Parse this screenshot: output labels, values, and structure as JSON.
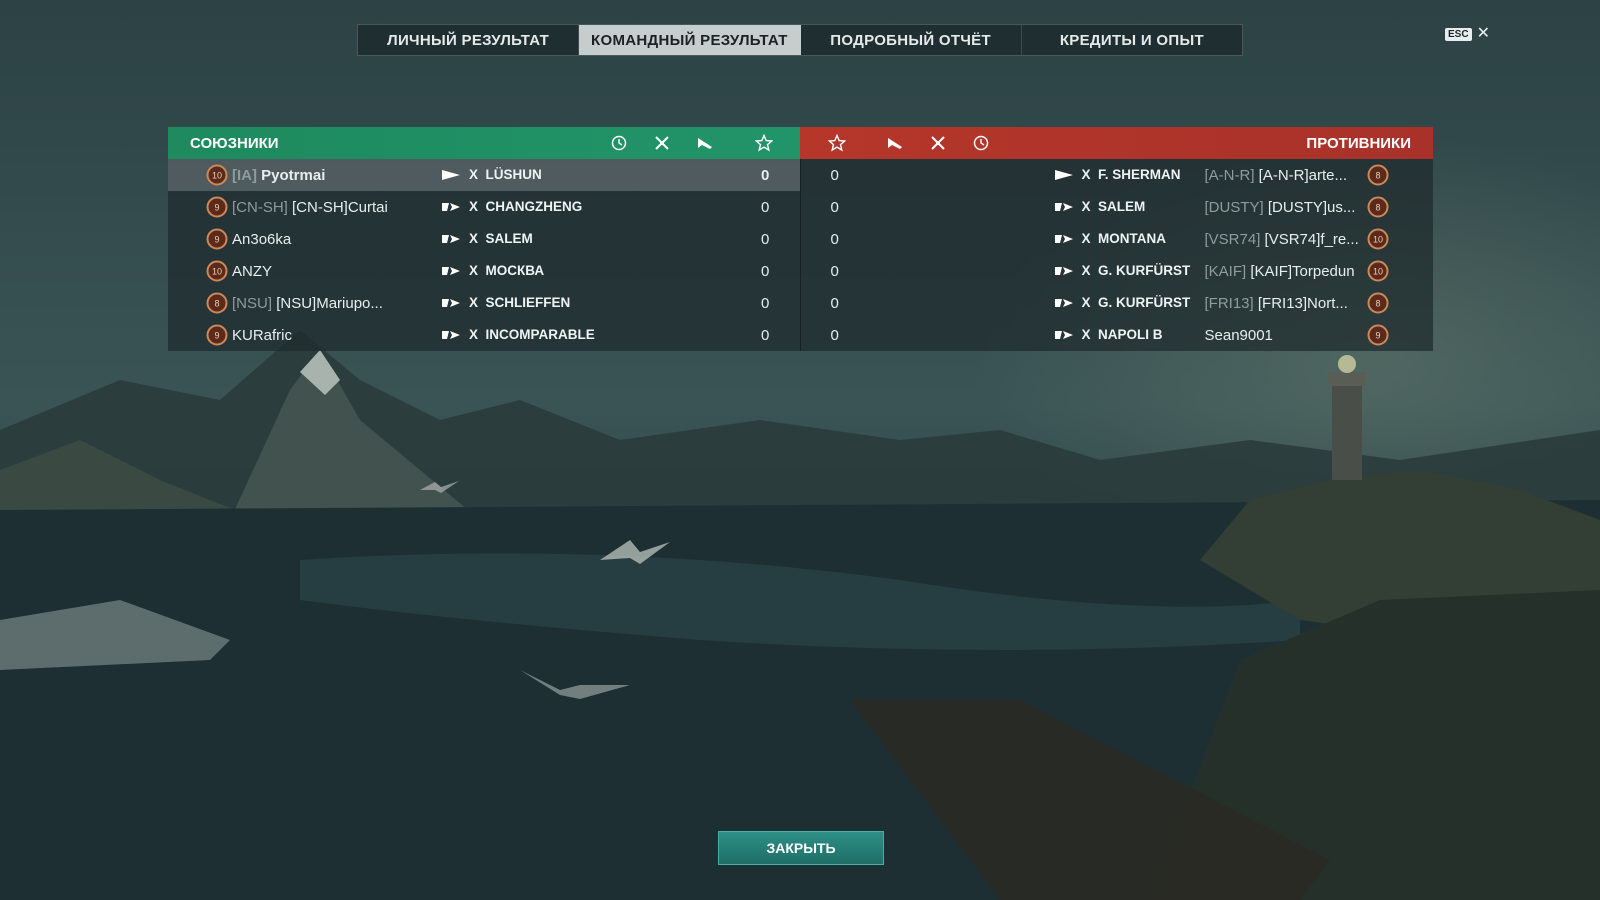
{
  "tabs": [
    {
      "label": "ЛИЧНЫЙ РЕЗУЛЬТАТ",
      "active": false
    },
    {
      "label": "КОМАНДНЫЙ РЕЗУЛЬТАТ",
      "active": true
    },
    {
      "label": "ПОДРОБНЫЙ ОТЧЁТ",
      "active": false
    },
    {
      "label": "КРЕДИТЫ И ОПЫТ",
      "active": false
    }
  ],
  "esc": {
    "key_label": "ESC",
    "close_glyph": "✕"
  },
  "allies": {
    "title": "СОЮЗНИКИ",
    "color": "#22946a",
    "header_icons": [
      "laurel-icon",
      "crossed-torpedo-icon",
      "plane-icon",
      "star-icon"
    ],
    "players": [
      {
        "rank": "10",
        "clan": "[IA]",
        "name": "Pyotrmai",
        "ship_tier": "X",
        "ship": "LÜSHUN",
        "score": "0",
        "me": true
      },
      {
        "rank": "9",
        "clan": "[CN-SH]",
        "name": "[CN-SH]Curtai",
        "ship_tier": "X",
        "ship": "CHANGZHENG",
        "score": "0"
      },
      {
        "rank": "9",
        "clan": "",
        "name": "An3o6ka",
        "ship_tier": "X",
        "ship": "SALEM",
        "score": "0"
      },
      {
        "rank": "10",
        "clan": "",
        "name": "ANZY",
        "ship_tier": "X",
        "ship": "МОСКВА",
        "score": "0"
      },
      {
        "rank": "8",
        "clan": "[NSU]",
        "name": "[NSU]Mariupo...",
        "ship_tier": "X",
        "ship": "SCHLIEFFEN",
        "score": "0"
      },
      {
        "rank": "9",
        "clan": "",
        "name": "KURafric",
        "ship_tier": "X",
        "ship": "INCOMPARABLE",
        "score": "0"
      }
    ]
  },
  "enemies": {
    "title": "ПРОТИВНИКИ",
    "color": "#b6362a",
    "header_icons": [
      "star-icon",
      "plane-icon",
      "crossed-torpedo-icon",
      "laurel-icon"
    ],
    "players": [
      {
        "rank": "8",
        "clan": "[A-N-R]",
        "name": "[A-N-R]arte...",
        "ship_tier": "X",
        "ship": "F. SHERMAN",
        "score": "0"
      },
      {
        "rank": "8",
        "clan": "[DUSTY]",
        "name": "[DUSTY]us...",
        "ship_tier": "X",
        "ship": "SALEM",
        "score": "0"
      },
      {
        "rank": "10",
        "clan": "[VSR74]",
        "name": "[VSR74]f_re...",
        "ship_tier": "X",
        "ship": "MONTANA",
        "score": "0"
      },
      {
        "rank": "10",
        "clan": "[KAIF]",
        "name": "[KAIF]Torpedun",
        "ship_tier": "X",
        "ship": "G. KURFÜRST",
        "score": "0"
      },
      {
        "rank": "8",
        "clan": "[FRI13]",
        "name": "[FRI13]Nort...",
        "ship_tier": "X",
        "ship": "G. KURFÜRST",
        "score": "0"
      },
      {
        "rank": "9",
        "clan": "",
        "name": "Sean9001",
        "ship_tier": "X",
        "ship": "NAPOLI B",
        "score": "0"
      }
    ]
  },
  "close_button": {
    "label": "ЗАКРЫТЬ"
  }
}
